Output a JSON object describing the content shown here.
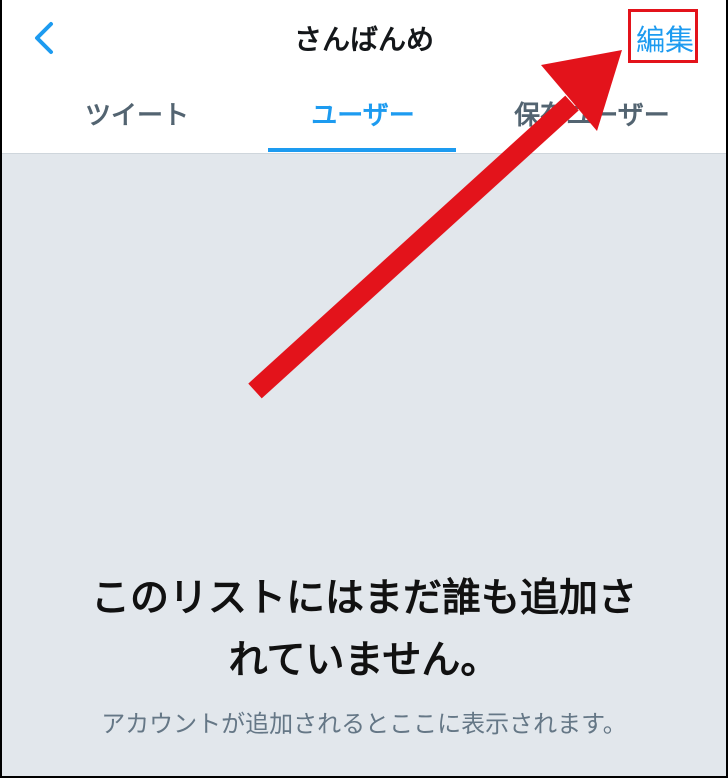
{
  "header": {
    "title": "さんばんめ",
    "edit_label": "編集"
  },
  "tabs": [
    {
      "label": "ツイート",
      "active": false
    },
    {
      "label": "ユーザー",
      "active": true
    },
    {
      "label": "保存ユーザー",
      "active": false
    }
  ],
  "empty_state": {
    "title_line1": "このリストにはまだ誰も追加さ",
    "title_line2": "れていません。",
    "subtitle": "アカウントが追加されるとここに表示されます。"
  },
  "colors": {
    "accent": "#1d9bf0",
    "annotation": "#e3131b",
    "background": "#e2e7ec"
  }
}
